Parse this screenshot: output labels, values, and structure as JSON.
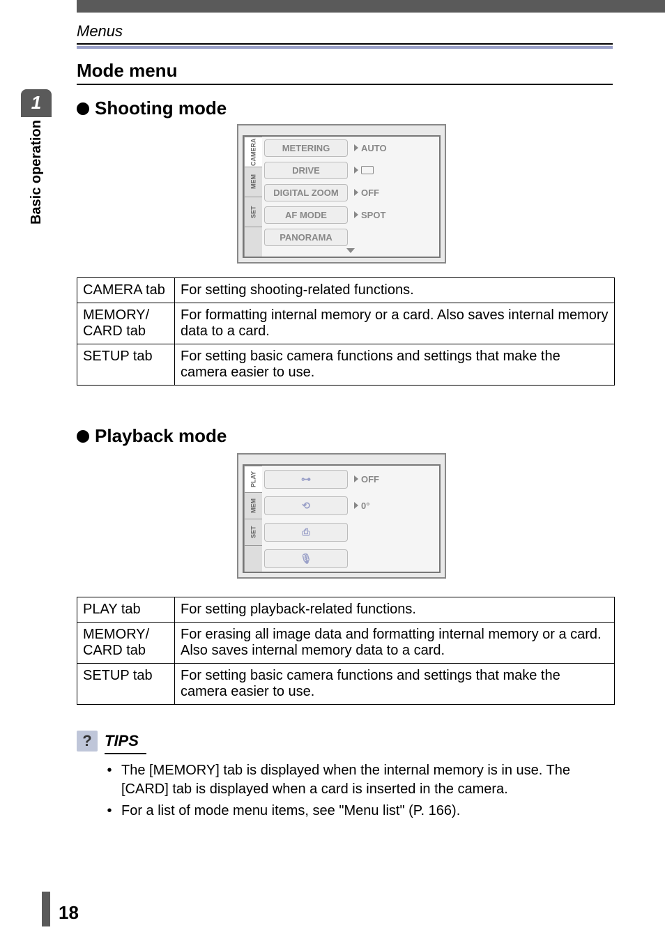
{
  "header_section": "Menus",
  "page_title": "Mode menu",
  "side_tab": {
    "number": "1",
    "label": "Basic operation"
  },
  "subheadings": {
    "shooting": "Shooting mode",
    "playback": "Playback mode"
  },
  "shooting_menu": {
    "tabs": [
      "CAMERA",
      "MEM",
      "SET"
    ],
    "rows": [
      {
        "label": "METERING",
        "value": "AUTO"
      },
      {
        "label": "DRIVE",
        "value": "rect"
      },
      {
        "label": "DIGITAL ZOOM",
        "value": "OFF"
      },
      {
        "label": "AF MODE",
        "value": "SPOT"
      },
      {
        "label": "PANORAMA",
        "value": ""
      }
    ]
  },
  "playback_menu": {
    "tabs": [
      "PLAY",
      "MEM",
      "SET"
    ],
    "rows": [
      {
        "icon": "protect",
        "value": "OFF"
      },
      {
        "icon": "rotate",
        "value": "0°"
      },
      {
        "icon": "print",
        "value": ""
      },
      {
        "icon": "mic",
        "value": ""
      }
    ]
  },
  "shooting_table": [
    {
      "key": "CAMERA tab",
      "desc": "For setting shooting-related functions."
    },
    {
      "key": "MEMORY/ CARD tab",
      "desc": "For formatting internal memory or a card. Also saves internal memory data to a card."
    },
    {
      "key": "SETUP tab",
      "desc": "For setting basic camera functions and settings that make the camera easier to use."
    }
  ],
  "playback_table": [
    {
      "key": "PLAY tab",
      "desc": "For setting playback-related functions."
    },
    {
      "key": "MEMORY/ CARD tab",
      "desc": "For erasing all image data and formatting internal memory or a card. Also saves internal memory data to a card."
    },
    {
      "key": "SETUP tab",
      "desc": "For setting basic camera functions and settings that make the camera easier to use."
    }
  ],
  "tips": {
    "label": "TIPS",
    "icon": "?",
    "items": [
      "The [MEMORY] tab is displayed when the internal memory is in use. The [CARD] tab is displayed when a card is inserted in the camera.",
      "For a list of mode menu items, see \"Menu list\" (P. 166)."
    ]
  },
  "page_number": "18"
}
